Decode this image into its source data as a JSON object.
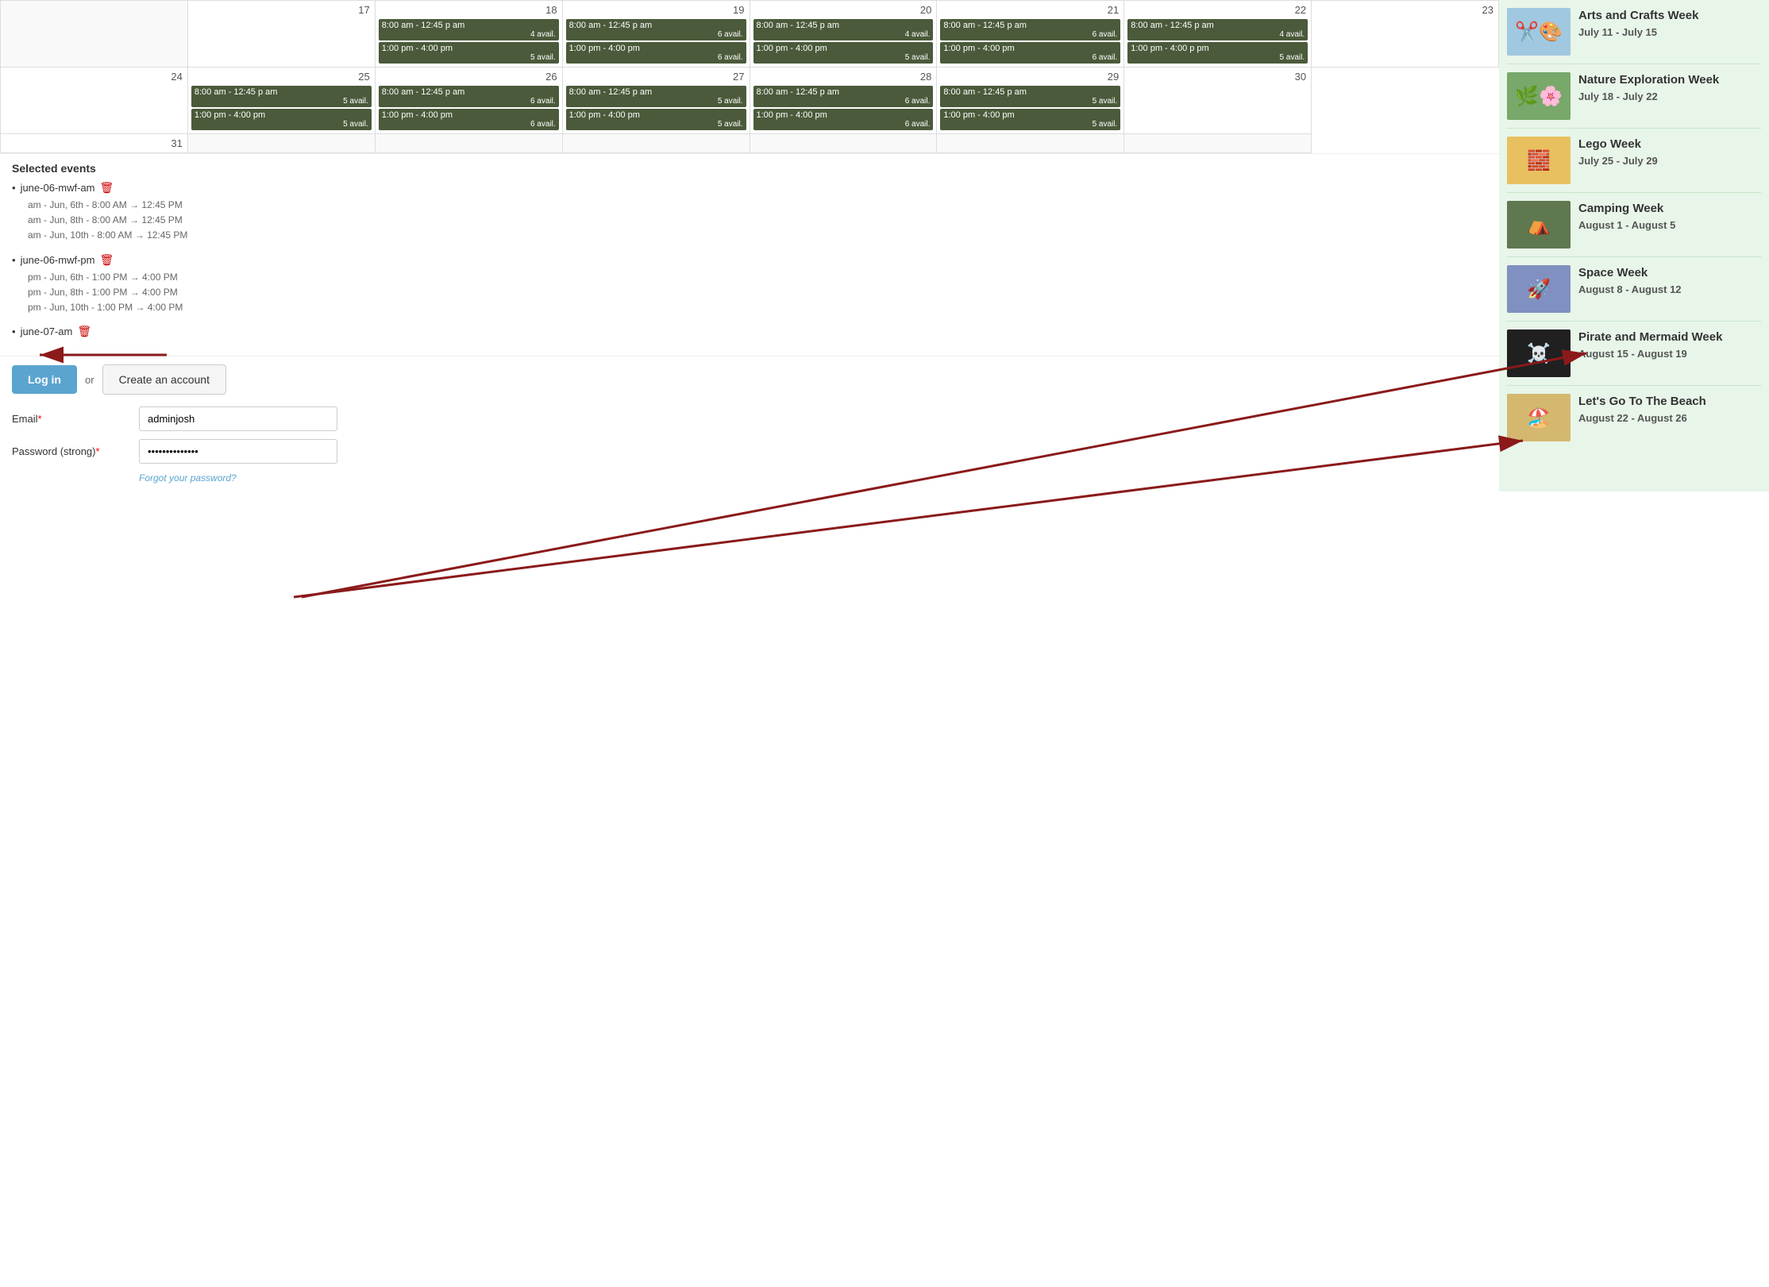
{
  "calendar": {
    "rows": [
      {
        "days": [
          {
            "num": "",
            "empty": true
          },
          {
            "num": 17,
            "events": []
          },
          {
            "num": 18,
            "events": [
              {
                "time": "8:00 am - 12:45 p am",
                "avail": "4 avail."
              },
              {
                "time": "1:00 pm - 4:00 pm",
                "avail": "5 avail."
              }
            ]
          },
          {
            "num": 19,
            "events": [
              {
                "time": "8:00 am - 12:45 p am",
                "avail": "6 avail."
              },
              {
                "time": "1:00 pm - 4:00 pm",
                "avail": "6 avail."
              }
            ]
          },
          {
            "num": 20,
            "events": [
              {
                "time": "8:00 am - 12:45 p am",
                "avail": "4 avail."
              },
              {
                "time": "1:00 pm - 4:00 pm",
                "avail": "5 avail."
              }
            ]
          },
          {
            "num": 21,
            "events": [
              {
                "time": "8:00 am - 12:45 p am",
                "avail": "6 avail."
              },
              {
                "time": "1:00 pm - 4:00 pm",
                "avail": "6 avail."
              }
            ]
          },
          {
            "num": 22,
            "events": [
              {
                "time": "8:00 am - 12:45 p am",
                "avail": "4 avail."
              },
              {
                "time": "1:00 pm - 4:00 p pm",
                "avail": "5 avail."
              }
            ]
          },
          {
            "num": 23,
            "events": []
          }
        ]
      },
      {
        "days": [
          {
            "num": 24,
            "events": []
          },
          {
            "num": 25,
            "events": [
              {
                "time": "8:00 am - 12:45 p am",
                "avail": "5 avail."
              },
              {
                "time": "1:00 pm - 4:00 pm",
                "avail": "5 avail."
              }
            ]
          },
          {
            "num": 26,
            "events": [
              {
                "time": "8:00 am - 12:45 p am",
                "avail": "6 avail."
              },
              {
                "time": "1:00 pm - 4:00 pm",
                "avail": "6 avail."
              }
            ]
          },
          {
            "num": 27,
            "events": [
              {
                "time": "8:00 am - 12:45 p am",
                "avail": "5 avail."
              },
              {
                "time": "1:00 pm - 4:00 pm",
                "avail": "5 avail."
              }
            ]
          },
          {
            "num": 28,
            "events": [
              {
                "time": "8:00 am - 12:45 p am",
                "avail": "6 avail."
              },
              {
                "time": "1:00 pm - 4:00 pm",
                "avail": "6 avail."
              }
            ]
          },
          {
            "num": 29,
            "events": [
              {
                "time": "8:00 am - 12:45 p am",
                "avail": "5 avail."
              },
              {
                "time": "1:00 pm - 4:00 pm",
                "avail": "5 avail."
              }
            ]
          },
          {
            "num": 30,
            "events": []
          }
        ]
      },
      {
        "days": [
          {
            "num": 31,
            "events": []
          },
          {
            "num": "",
            "empty": true
          },
          {
            "num": "",
            "empty": true
          },
          {
            "num": "",
            "empty": true
          },
          {
            "num": "",
            "empty": true
          },
          {
            "num": "",
            "empty": true
          },
          {
            "num": "",
            "empty": true
          }
        ]
      }
    ]
  },
  "selected_events": {
    "title": "Selected events",
    "groups": [
      {
        "id": "june-06-mwf-am",
        "details": [
          "am - Jun, 6th - 8:00 AM → 12:45 PM",
          "am - Jun, 8th - 8:00 AM → 12:45 PM",
          "am - Jun, 10th - 8:00 AM → 12:45 PM"
        ]
      },
      {
        "id": "june-06-mwf-pm",
        "details": [
          "pm - Jun, 6th - 1:00 PM → 4:00 PM",
          "pm - Jun, 8th - 1:00 PM → 4:00 PM",
          "pm - Jun, 10th - 1:00 PM → 4:00 PM"
        ]
      },
      {
        "id": "june-07-am",
        "details": []
      }
    ]
  },
  "auth": {
    "login_label": "Log in",
    "or_label": "or",
    "create_account_label": "Create an account",
    "email_label": "Email",
    "email_required": "*",
    "email_value": "adminjosh",
    "password_label": "Password (strong)",
    "password_required": "*",
    "password_value": "••••••••••••••",
    "forgot_label": "Forgot your password?"
  },
  "sidebar": {
    "items": [
      {
        "title": "Arts and Crafts Week",
        "dates": "July 11 - July 15",
        "color": "#a8d8ea",
        "img_type": "crafts"
      },
      {
        "title": "Nature Exploration Week",
        "dates": "July 18 - July 22",
        "color": "#b8d8b8",
        "img_type": "nature"
      },
      {
        "title": "Lego Week",
        "dates": "July 25 - July 29",
        "color": "#f0c080",
        "img_type": "lego"
      },
      {
        "title": "Camping Week",
        "dates": "August 1 - August 5",
        "color": "#a0c0a0",
        "img_type": "camping"
      },
      {
        "title": "Space Week",
        "dates": "August 8 - August 12",
        "color": "#c0c0e0",
        "img_type": "space"
      },
      {
        "title": "Pirate and Mermaid Week",
        "dates": "August 15 - August 19",
        "color": "#303030",
        "img_type": "pirate"
      },
      {
        "title": "Let's Go To The Beach",
        "dates": "August 22 - August 26",
        "color": "#e8d090",
        "img_type": "beach"
      }
    ]
  }
}
